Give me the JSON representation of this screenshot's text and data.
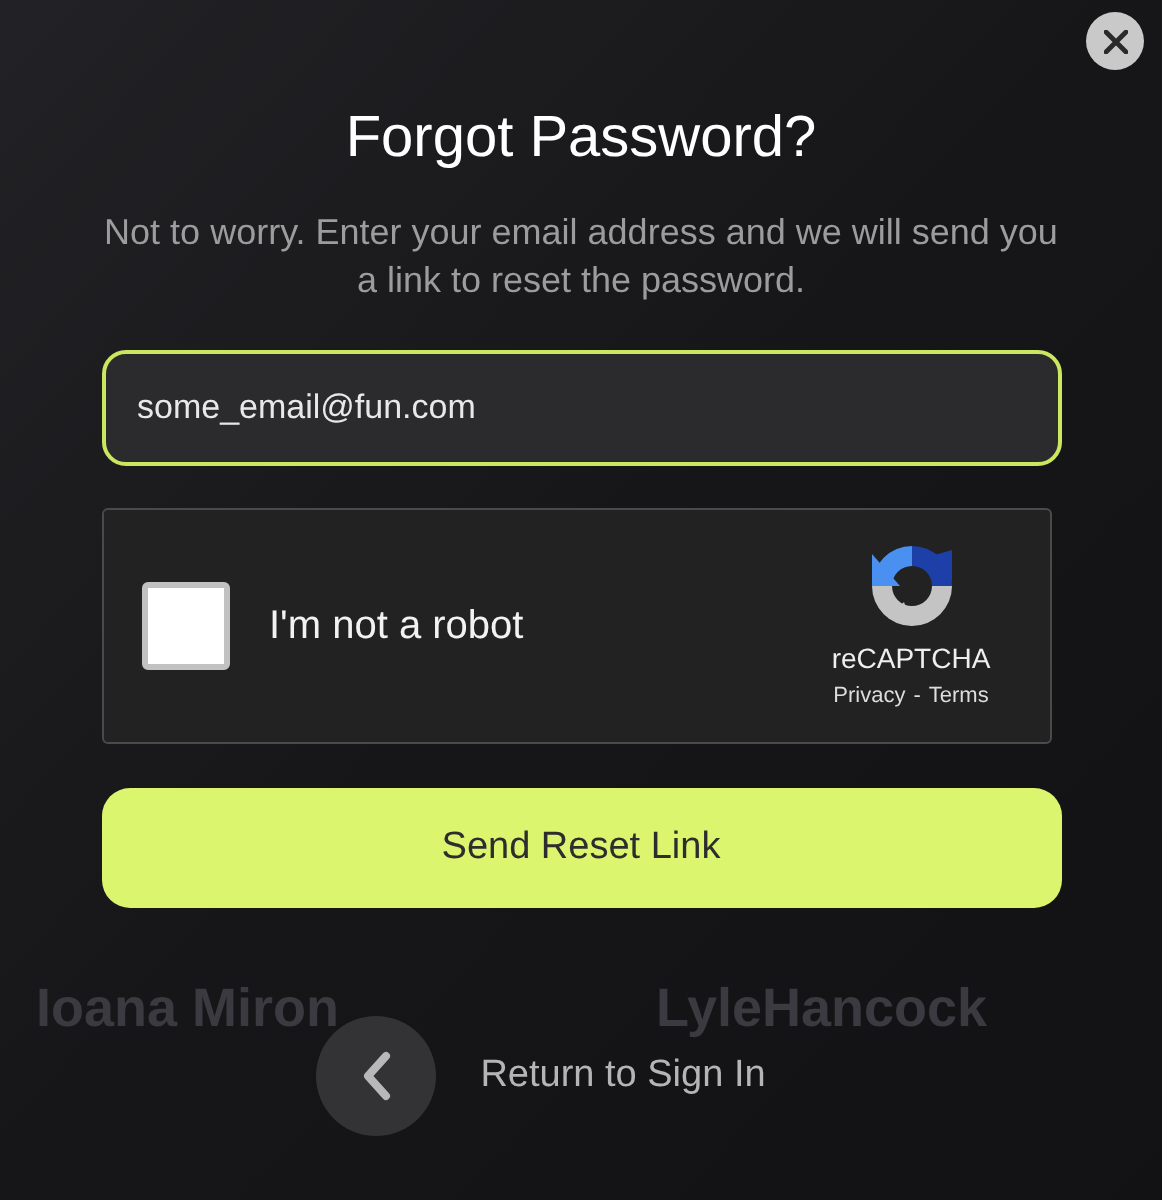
{
  "background_names": [
    "Ioana Miron",
    "LyleHancock"
  ],
  "dialog": {
    "title": "Forgot Password?",
    "description": "Not to worry. Enter your email address and we will send you a link to reset the password.",
    "email_field": {
      "value": "some_email@fun.com"
    },
    "captcha": {
      "checked": false,
      "label": "I'm not a robot",
      "brand": "reCAPTCHA",
      "privacy": "Privacy",
      "separator": "-",
      "terms": "Terms"
    },
    "submit": "Send Reset Link",
    "back_link": "Return to Sign In"
  }
}
